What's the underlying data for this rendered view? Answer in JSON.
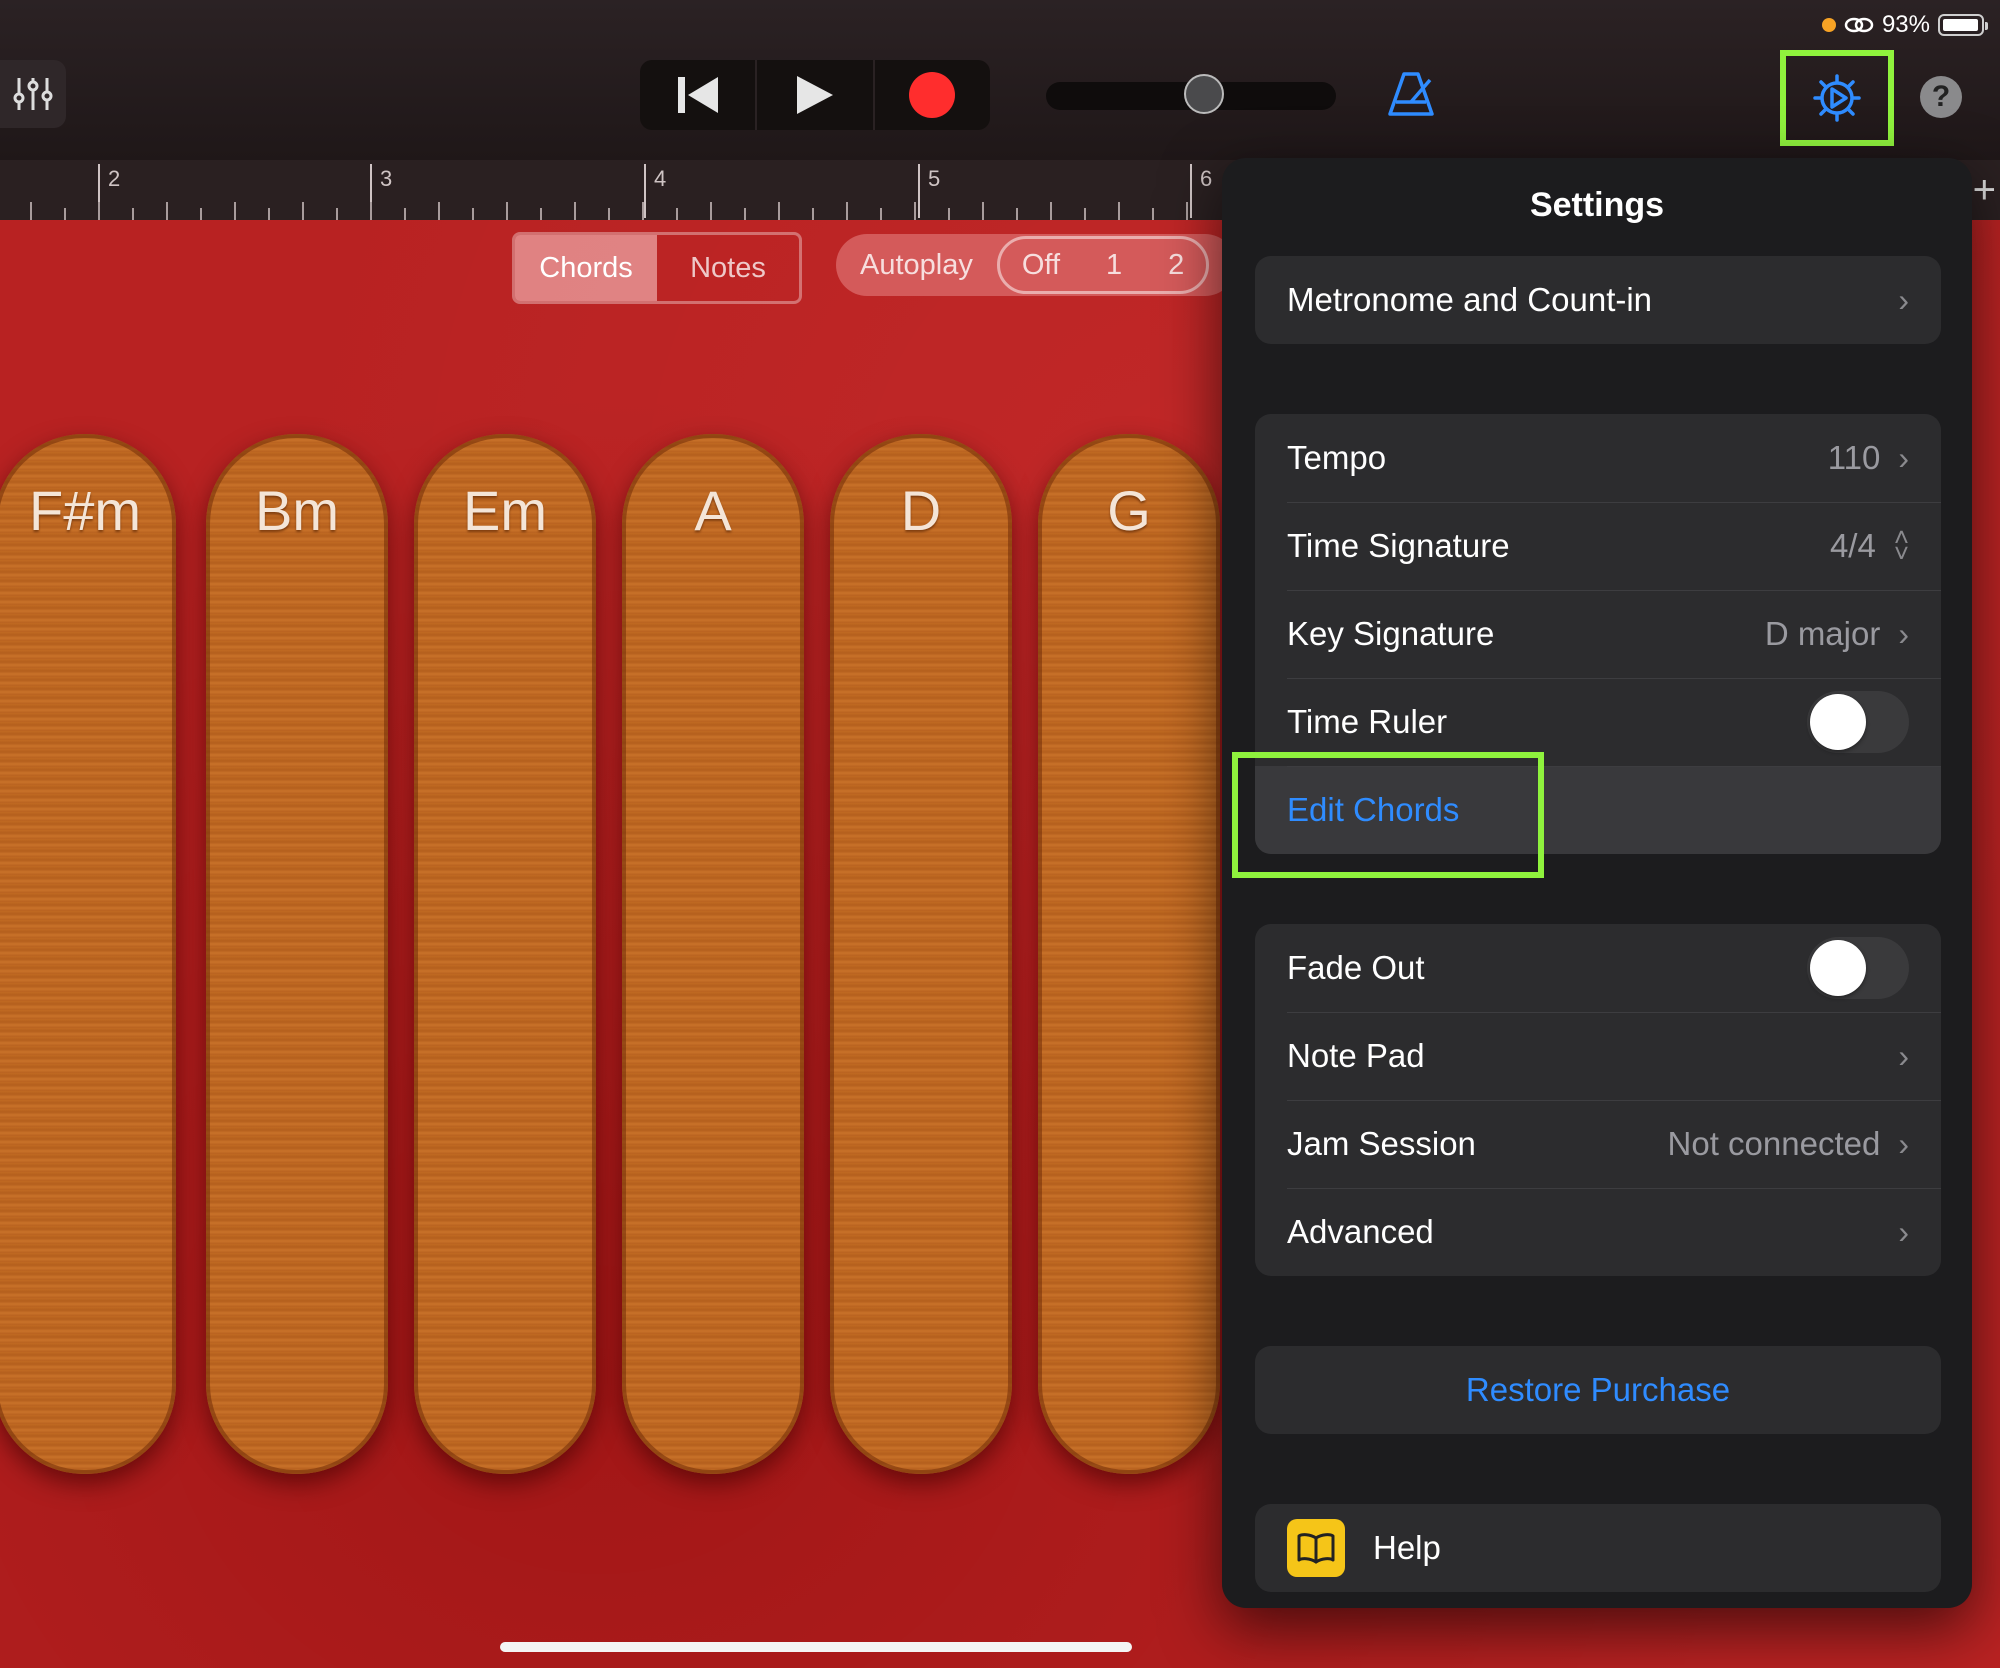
{
  "status": {
    "battery": "93%"
  },
  "toolbar": {
    "icons": [
      "mixer-icon",
      "skip-back-icon",
      "play-icon",
      "record-icon",
      "metronome-icon",
      "settings-gear-icon",
      "help-question-icon"
    ],
    "help_label": "?",
    "accent": "#2f8cff",
    "record_color": "#ff2d2d",
    "highlight_color": "#8ff23d"
  },
  "ruler": {
    "bars": [
      "2",
      "3",
      "4",
      "5",
      "6"
    ],
    "add_label": "+"
  },
  "controls": {
    "chords_label": "Chords",
    "notes_label": "Notes",
    "autoplay_label": "Autoplay",
    "autoplay_options": [
      "Off",
      "1",
      "2"
    ]
  },
  "chords": [
    "F#m",
    "Bm",
    "Em",
    "A",
    "D",
    "G"
  ],
  "settings": {
    "title": "Settings",
    "metronome": "Metronome and Count-in",
    "tempo": {
      "label": "Tempo",
      "value": "110"
    },
    "time_signature": {
      "label": "Time Signature",
      "value": "4/4"
    },
    "key_signature": {
      "label": "Key Signature",
      "value": "D major"
    },
    "time_ruler": {
      "label": "Time Ruler",
      "on": false
    },
    "edit_chords": "Edit Chords",
    "fade_out": {
      "label": "Fade Out",
      "on": false
    },
    "note_pad": "Note Pad",
    "jam_session": {
      "label": "Jam Session",
      "value": "Not connected"
    },
    "advanced": "Advanced",
    "restore": "Restore Purchase",
    "help": "Help"
  }
}
